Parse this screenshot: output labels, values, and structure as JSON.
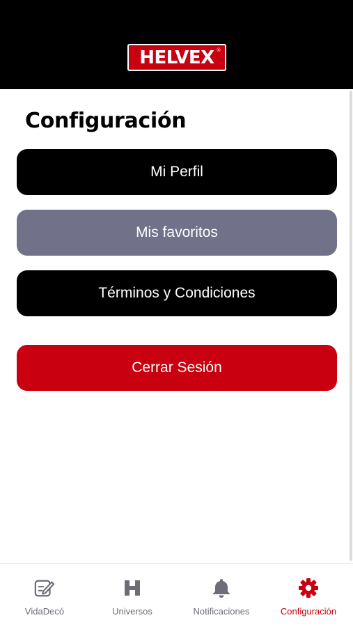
{
  "header": {
    "logo_text": "HELVEX",
    "logo_mark": "®"
  },
  "page": {
    "title": "Configuración"
  },
  "menu": {
    "profile_label": "Mi Perfil",
    "favorites_label": "Mis favoritos",
    "terms_label": "Términos y Condiciones",
    "logout_label": "Cerrar Sesión"
  },
  "tabbar": {
    "items": [
      {
        "label": "VidaDecó",
        "icon": "edit-note-icon",
        "active": false
      },
      {
        "label": "Universos",
        "icon": "h-logo-icon",
        "active": false
      },
      {
        "label": "Notificaciones",
        "icon": "bell-icon",
        "active": false
      },
      {
        "label": "Configuración",
        "icon": "gear-icon",
        "active": true
      }
    ]
  },
  "colors": {
    "brand_red": "#c8000f",
    "header_black": "#000000",
    "favorites_gray": "#72718a",
    "inactive_tab": "#6d6d78"
  }
}
